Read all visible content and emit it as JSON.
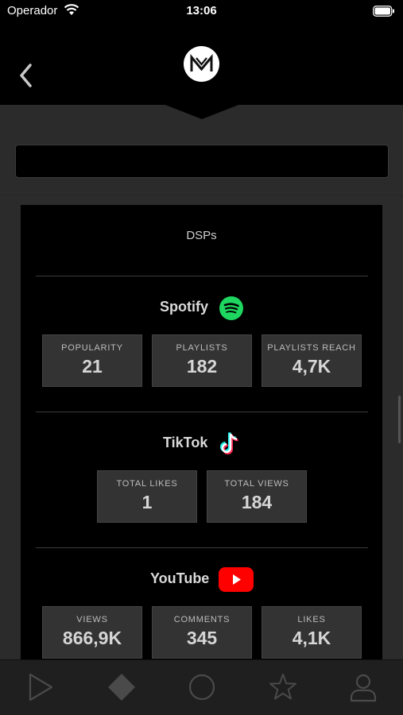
{
  "status_bar": {
    "carrier": "Operador",
    "time": "13:06"
  },
  "header": {
    "back_icon": "chevron-left-icon",
    "logo_icon": "app-logo-icon"
  },
  "card": {
    "title": "DSPs",
    "sections": [
      {
        "name": "Spotify",
        "icon": "spotify-icon",
        "color": "#1ed760",
        "stats": [
          {
            "label": "POPULARITY",
            "value": "21"
          },
          {
            "label": "PLAYLISTS",
            "value": "182"
          },
          {
            "label": "PLAYLISTS REACH",
            "value": "4,7K"
          }
        ]
      },
      {
        "name": "TikTok",
        "icon": "tiktok-icon",
        "colors": [
          "#25f4ee",
          "#fe2c55"
        ],
        "stats": [
          {
            "label": "TOTAL LIKES",
            "value": "1"
          },
          {
            "label": "TOTAL VIEWS",
            "value": "184"
          }
        ]
      },
      {
        "name": "YouTube",
        "icon": "youtube-icon",
        "color": "#ff0000",
        "stats": [
          {
            "label": "VIEWS",
            "value": "866,9K"
          },
          {
            "label": "COMMENTS",
            "value": "345"
          },
          {
            "label": "LIKES",
            "value": "4,1K"
          }
        ]
      }
    ]
  },
  "tab_bar": {
    "tabs": [
      {
        "icon": "play-icon"
      },
      {
        "icon": "diamond-icon",
        "active": true
      },
      {
        "icon": "circle-icon"
      },
      {
        "icon": "star-icon"
      },
      {
        "icon": "profile-icon"
      }
    ]
  }
}
